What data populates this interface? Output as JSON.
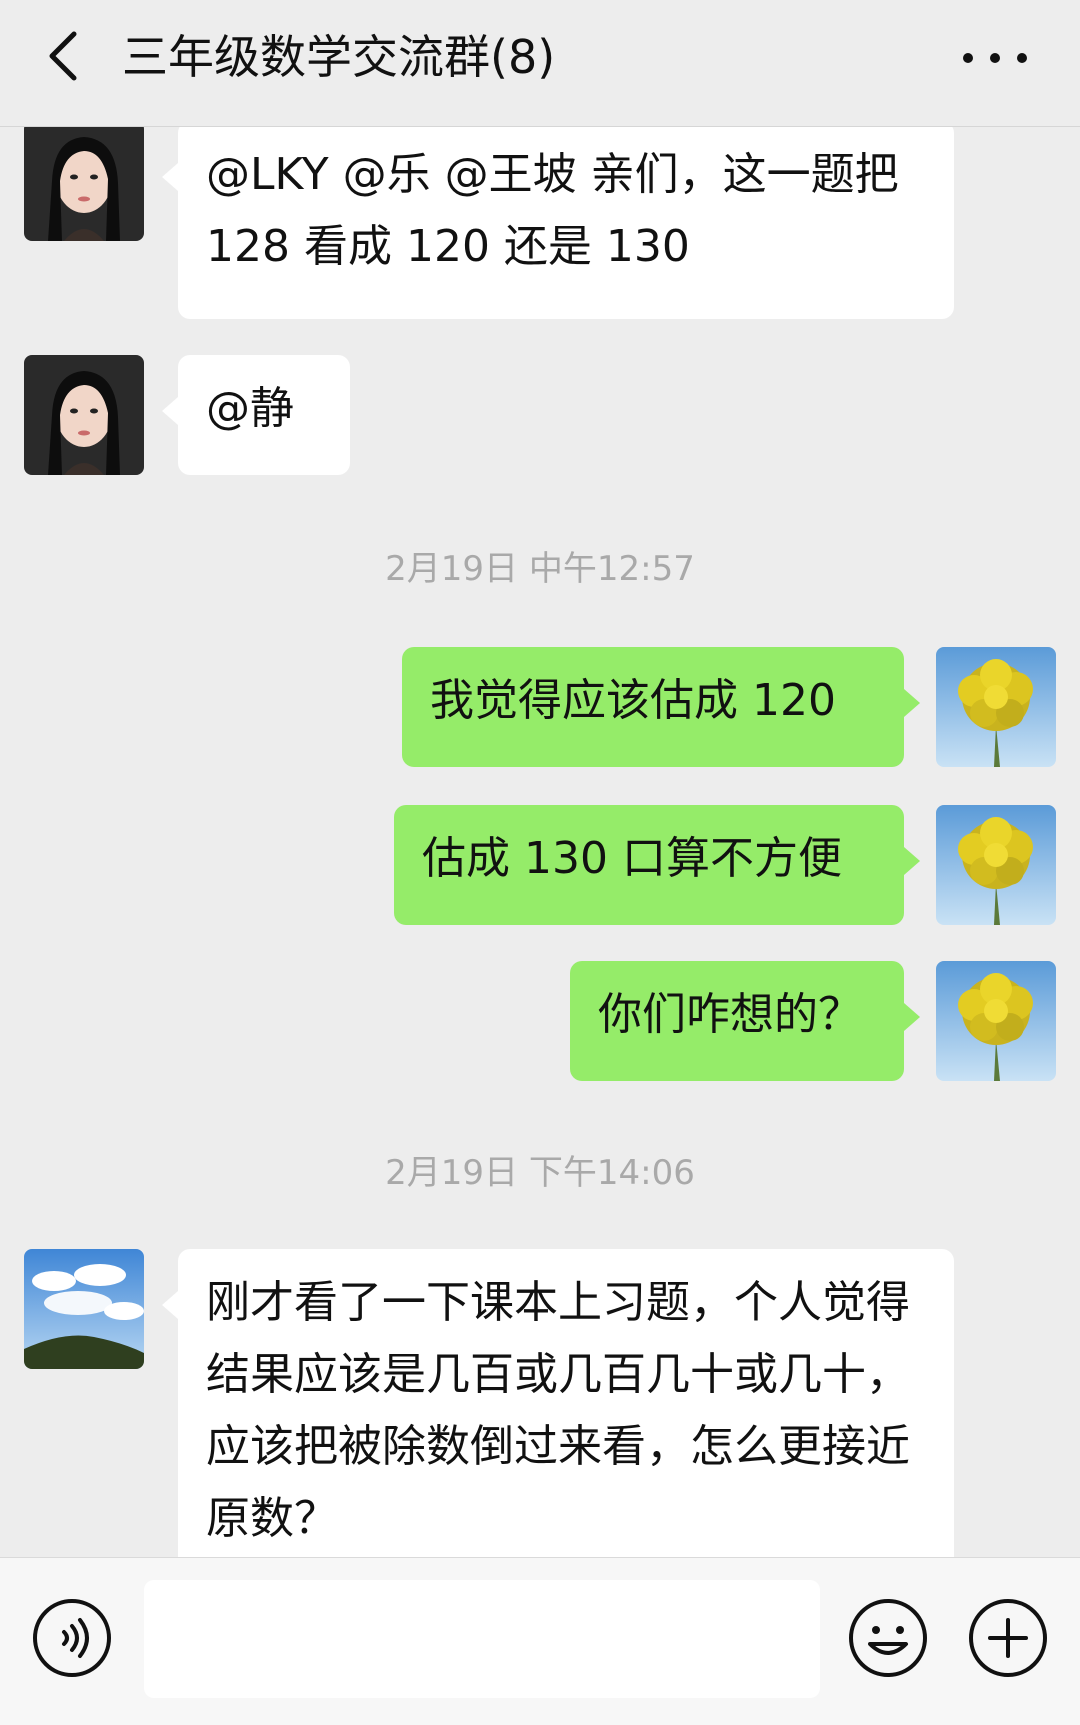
{
  "header": {
    "title": "三年级数学交流群(8)",
    "back_icon": "chevron-left-icon",
    "more_icon": "more-dots-icon"
  },
  "messages": [
    {
      "side": "left",
      "avatar": "girl-photo-avatar",
      "text": "@LKY @乐  @王坡  亲们，这一题把 128 看成 120 还是 130"
    },
    {
      "side": "left",
      "avatar": "girl-photo-avatar",
      "text": "@静"
    },
    {
      "type": "time",
      "text": "2月19日 中午12:57"
    },
    {
      "side": "right",
      "avatar": "yellow-flowers-avatar",
      "text": "我觉得应该估成 120"
    },
    {
      "side": "right",
      "avatar": "yellow-flowers-avatar",
      "text": "估成 130 口算不方便"
    },
    {
      "side": "right",
      "avatar": "yellow-flowers-avatar",
      "text": "你们咋想的？"
    },
    {
      "type": "time",
      "text": "2月19日 下午14:06"
    },
    {
      "side": "left",
      "avatar": "sky-landscape-avatar",
      "text": "刚才看了一下课本上习题，个人觉得结果应该是几百或几百几十或几十，应该把被除数倒过来看，怎么更接近原数？"
    }
  ],
  "input_bar": {
    "voice_icon": "voice-icon",
    "input_value": "",
    "emoji_icon": "emoji-icon",
    "plus_icon": "plus-icon"
  },
  "colors": {
    "background": "#ededed",
    "green_bubble": "#95ec69",
    "white_bubble": "#ffffff",
    "timestamp": "#a9a9a9"
  }
}
